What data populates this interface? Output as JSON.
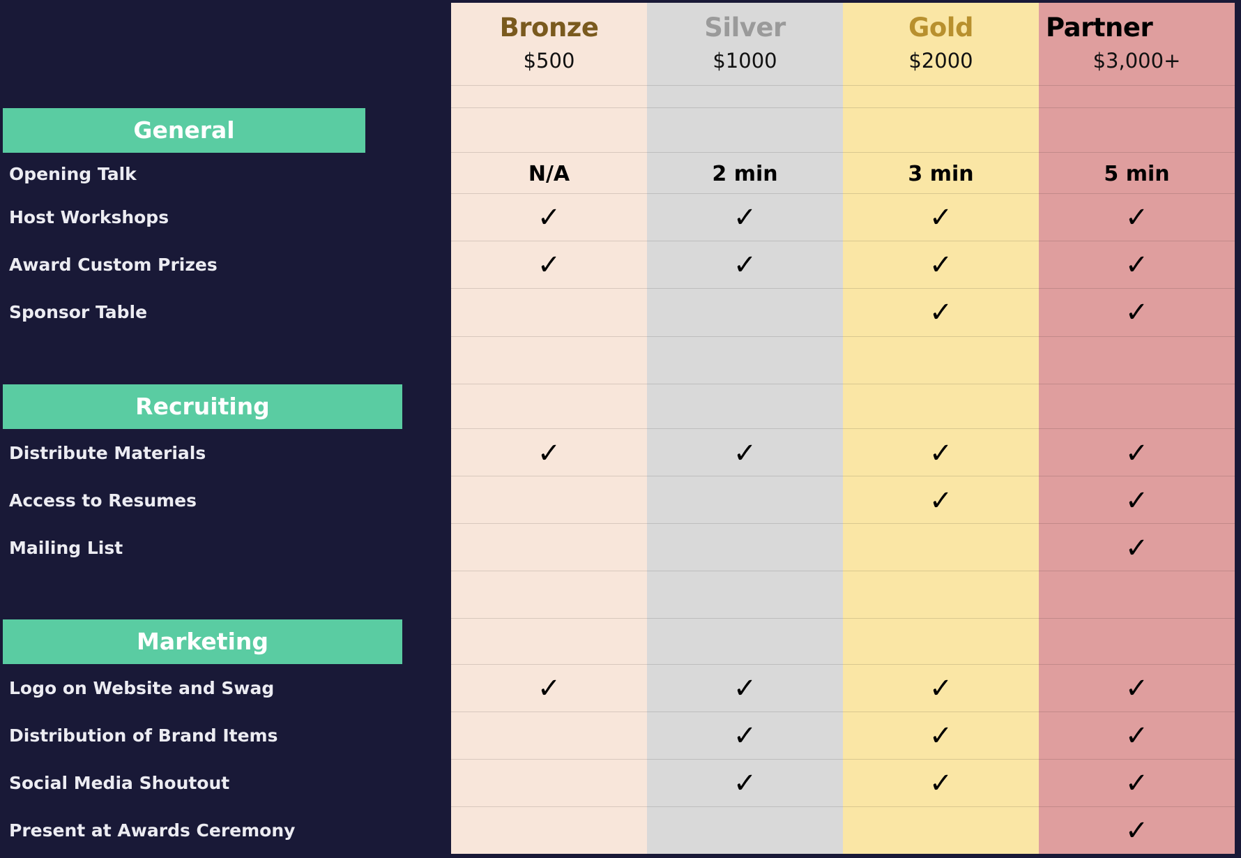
{
  "check_symbol": "✓",
  "tiers": [
    {
      "name": "Bronze",
      "price": "$500",
      "name_color": "#7a5a1e",
      "bg": "#f8e6da"
    },
    {
      "name": "Silver",
      "price": "$1000",
      "name_color": "#9a9a9a",
      "bg": "#d9d9d9"
    },
    {
      "name": "Gold",
      "price": "$2000",
      "name_color": "#b8902e",
      "bg": "#fae6a5"
    },
    {
      "name": "Partner",
      "price": "$3,000+",
      "name_color": "#000000",
      "bg": "#df9e9e"
    }
  ],
  "sections": [
    {
      "title": "General",
      "features": [
        {
          "label": "Opening Talk",
          "values": [
            "N/A",
            "2 min",
            "3 min",
            "5 min"
          ]
        },
        {
          "label": "Host Workshops",
          "values": [
            true,
            true,
            true,
            true
          ]
        },
        {
          "label": "Award Custom Prizes",
          "values": [
            true,
            true,
            true,
            true
          ]
        },
        {
          "label": "Sponsor Table",
          "values": [
            false,
            false,
            true,
            true
          ]
        }
      ]
    },
    {
      "title": "Recruiting",
      "features": [
        {
          "label": "Distribute Materials",
          "values": [
            true,
            true,
            true,
            true
          ]
        },
        {
          "label": "Access to Resumes",
          "values": [
            false,
            false,
            true,
            true
          ]
        },
        {
          "label": "Mailing List",
          "values": [
            false,
            false,
            false,
            true
          ]
        }
      ]
    },
    {
      "title": "Marketing",
      "features": [
        {
          "label": "Logo on Website and Swag",
          "values": [
            true,
            true,
            true,
            true
          ]
        },
        {
          "label": "Distribution of Brand Items",
          "values": [
            false,
            true,
            true,
            true
          ]
        },
        {
          "label": "Social Media Shoutout",
          "values": [
            false,
            true,
            true,
            true
          ]
        },
        {
          "label": "Present at Awards Ceremony",
          "values": [
            false,
            false,
            false,
            true
          ]
        }
      ]
    }
  ],
  "badge_color": "#5acca2",
  "page_background": "#191937"
}
